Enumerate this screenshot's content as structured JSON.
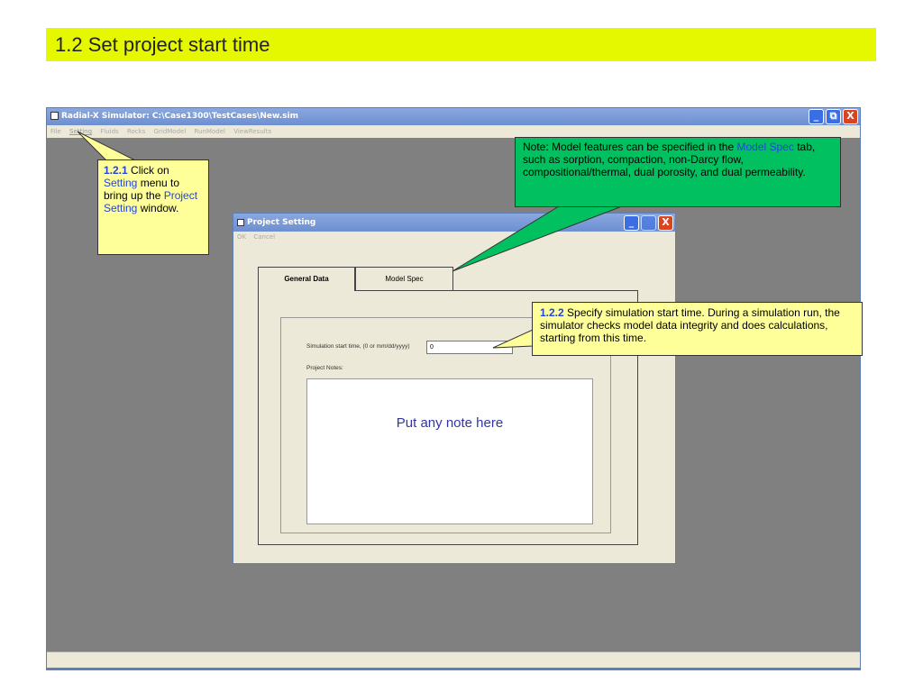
{
  "slide": {
    "title": "1.2 Set project start time"
  },
  "main_window": {
    "title": "Radial-X Simulator:   C:\\Case1300\\TestCases\\New.sim",
    "menu": [
      "File",
      "Setting",
      "Fluids",
      "Rocks",
      "GridModel",
      "RunModel",
      "ViewResults"
    ],
    "controls": {
      "minimize": "_",
      "restore": "⧉",
      "close": "X"
    }
  },
  "dialog": {
    "title": "Project Setting",
    "menu": [
      "OK",
      "Cancel"
    ],
    "tabs": [
      "General Data",
      "Model Spec"
    ],
    "start_time_label": "Simulation start time, (0 or mm/dd/yyyy)",
    "start_time_value": "0",
    "notes_label": "Project Notes:",
    "notes_text": "Put any note here"
  },
  "callouts": {
    "c1": {
      "num": "1.2.1",
      "t1": " Click on ",
      "t2": "Setting",
      "t3": " menu to bring up the ",
      "t4": "Project Setting",
      "t5": " window."
    },
    "c2": {
      "t1": "Note: Model features can be specified in the ",
      "t2": "Model Spec",
      "t3": " tab, such as sorption, compaction, non-Darcy flow, compositional/thermal, dual porosity, and dual permeability."
    },
    "c3": {
      "num": "1.2.2",
      "t1": " Specify simulation start time. During a simulation run, the simulator checks model data integrity and does calculations, starting from this time."
    }
  },
  "colors": {
    "title_bar": "#e6f800",
    "callout_yellow": "#ffff99",
    "callout_green": "#00c060",
    "link_blue": "#2244dd"
  }
}
